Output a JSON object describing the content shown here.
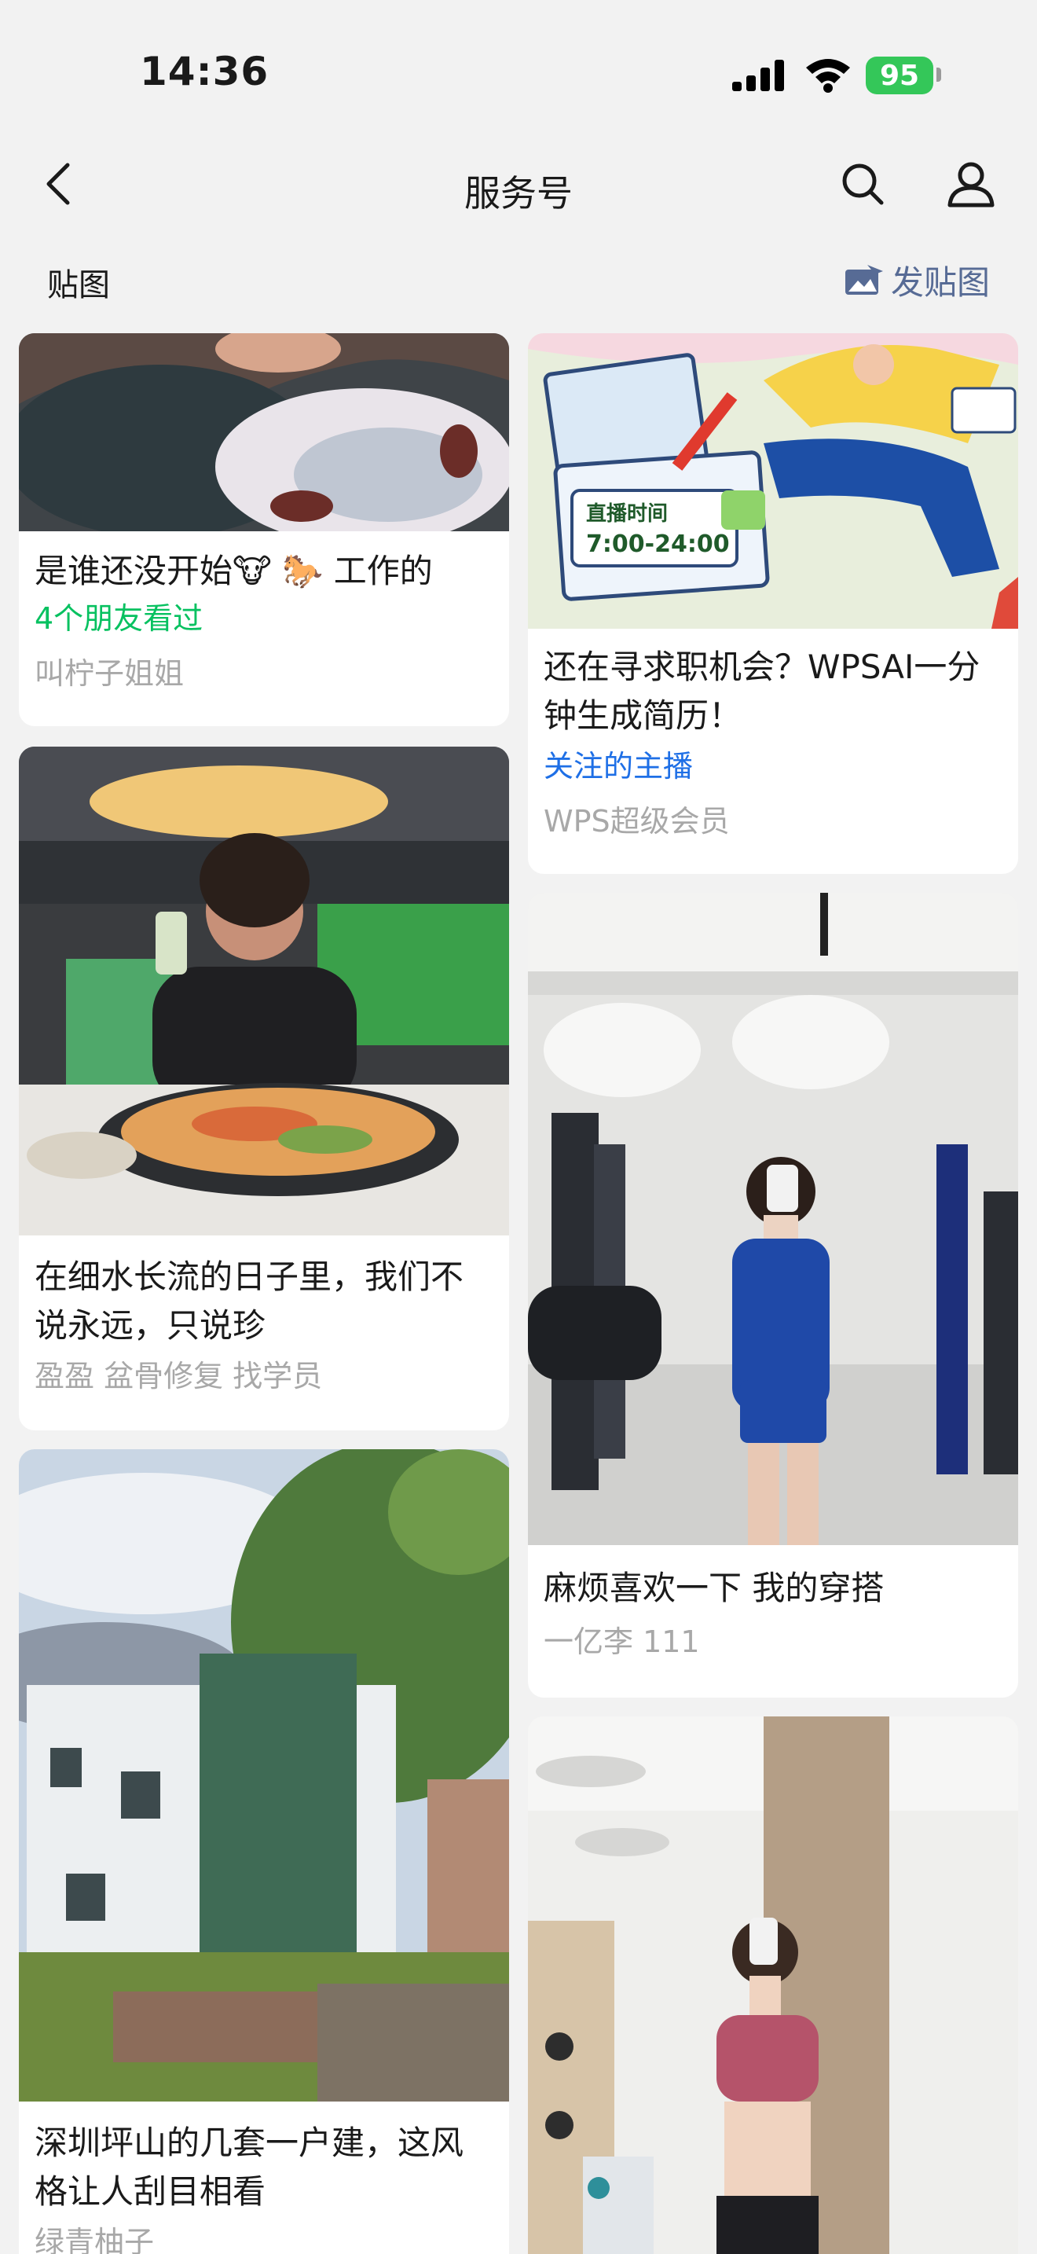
{
  "status_bar": {
    "time": "14:36",
    "battery": "95"
  },
  "nav": {
    "title": "服务号"
  },
  "section": {
    "title": "贴图",
    "post_label": "发贴图"
  },
  "cards": [
    {
      "title": "是谁还没开始🐮 🐎 工作的",
      "friends": "4个朋友看过",
      "author": "叫柠子姐姐"
    },
    {
      "title": "在细水长流的日子里，我们不说永远，只说珍",
      "author": "盈盈 盆骨修复 找学员"
    },
    {
      "title": "深圳坪山的几套一户建，这风格让人刮目相看",
      "author": "绿青柚子"
    },
    {
      "title": "还在寻求职机会？WPSAI一分钟生成简历！",
      "poster_line1": "直播时间",
      "poster_line2": "7:00-24:00",
      "tag": "关注的主播",
      "author": "WPS超级会员"
    },
    {
      "title": "麻烦喜欢一下  我的穿搭",
      "author": "一亿李 111"
    },
    {
      "title": ""
    }
  ]
}
